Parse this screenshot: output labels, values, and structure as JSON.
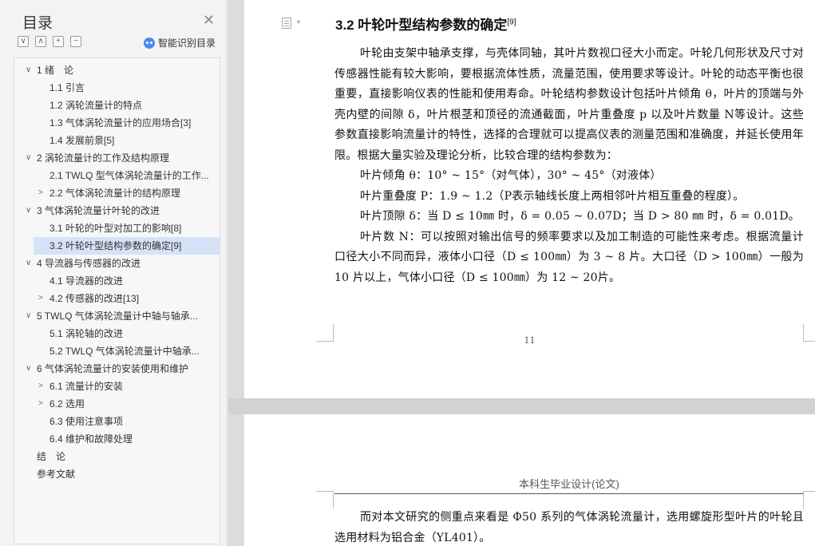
{
  "sidebar": {
    "title": "目录",
    "tools": [
      "∨",
      "∧",
      "+",
      "−"
    ],
    "smart_toc_label": "智能识别目录",
    "items": [
      {
        "label": "1 绪　论",
        "level": 1,
        "caret": "∨"
      },
      {
        "label": "1.1  引言",
        "level": 2,
        "caret": ""
      },
      {
        "label": "1.2  涡轮流量计的特点",
        "level": 2,
        "caret": ""
      },
      {
        "label": "1.3 气体涡轮流量计的应用场合[3]",
        "level": 2,
        "caret": ""
      },
      {
        "label": "1.4  发展前景[5]",
        "level": 2,
        "caret": ""
      },
      {
        "label": "2 涡轮流量计的工作及结构原理",
        "level": 1,
        "caret": "∨"
      },
      {
        "label": "2.1 TWLQ 型气体涡轮流量计的工作...",
        "level": 2,
        "caret": ""
      },
      {
        "label": "2.2 气体涡轮流量计的结构原理",
        "level": 2,
        "caret": ">"
      },
      {
        "label": "3 气体涡轮流量计叶轮的改进",
        "level": 1,
        "caret": "∨"
      },
      {
        "label": "3.1 叶轮的叶型对加工的影响[8]",
        "level": 2,
        "caret": ""
      },
      {
        "label": "3.2 叶轮叶型结构参数的确定[9]",
        "level": 2,
        "caret": "",
        "selected": true
      },
      {
        "label": "4  导流器与传感器的改进",
        "level": 1,
        "caret": "∨"
      },
      {
        "label": "4.1 导流器的改进",
        "level": 2,
        "caret": ""
      },
      {
        "label": "4.2 传感器的改进[13]",
        "level": 2,
        "caret": ">"
      },
      {
        "label": "5 TWLQ 气体涡轮流量计中轴与轴承...",
        "level": 1,
        "caret": "∨"
      },
      {
        "label": "5.1  涡轮轴的改进",
        "level": 2,
        "caret": ""
      },
      {
        "label": "5.2 TWLQ 气体涡轮流量计中轴承...",
        "level": 2,
        "caret": ""
      },
      {
        "label": "6 气体涡轮流量计的安装使用和维护",
        "level": 1,
        "caret": "∨"
      },
      {
        "label": "6.1 流量计的安装",
        "level": 2,
        "caret": ">"
      },
      {
        "label": "6.2 选用",
        "level": 2,
        "caret": ">"
      },
      {
        "label": "6.3 使用注意事项",
        "level": 2,
        "caret": ""
      },
      {
        "label": "6.4 维护和故障处理",
        "level": 2,
        "caret": ""
      },
      {
        "label": "结　论",
        "level": 1,
        "caret": ""
      },
      {
        "label": "参考文献",
        "level": 1,
        "caret": ""
      }
    ]
  },
  "document": {
    "page1": {
      "heading": "3.2 叶轮叶型结构参数的确定",
      "heading_ref": "[9]",
      "paragraphs": [
        "叶轮由支架中轴承支撑，与壳体同轴，其叶片数视口径大小而定。叶轮几何形状及尺寸对传感器性能有较大影响，要根据流体性质，流量范围，使用要求等设计。叶轮的动态平衡也很重要，直接影响仪表的性能和使用寿命。叶轮结构参数设计包括叶片倾角 θ，叶片的顶端与外壳内壁的间隙 δ，叶片根茎和顶径的流通截面，叶片重叠度 p 以及叶片数量 N等设计。这些参数直接影响流量计的特性，选择的合理就可以提高仪表的测量范围和准确度，并延长使用年限。根据大量实验及理论分析，比较合理的结构参数为：",
        "叶片倾角 θ：10° ~ 15°（对气体），30° ~ 45°（对液体）",
        "叶片重叠度 P：1.9 ~ 1.2（P表示轴线长度上两相邻叶片相互重叠的程度）。",
        "叶片顶隙 δ：当 D ≤ 10㎜ 时，δ = 0.05 ~ 0.07D；当 D > 80 ㎜ 时，δ = 0.01D。",
        "叶片数 N：可以按照对输出信号的频率要求以及加工制造的可能性来考虑。根据流量计口径大小不同而异，液体小口径（D ≤ 100㎜）为 3 ~ 8 片。大口径（D > 100㎜）一般为 10 片以上，气体小口径（D ≤ 100㎜）为 12 ~ 20片。"
      ],
      "page_number": "11"
    },
    "page2": {
      "running_header": "本科生毕业设计(论文)",
      "paragraphs": [
        "而对本文研究的侧重点来看是 Φ50 系列的气体涡轮流量计，选用螺旋形型叶片的叶轮且选用材料为铝合金（YL401）。"
      ]
    }
  }
}
